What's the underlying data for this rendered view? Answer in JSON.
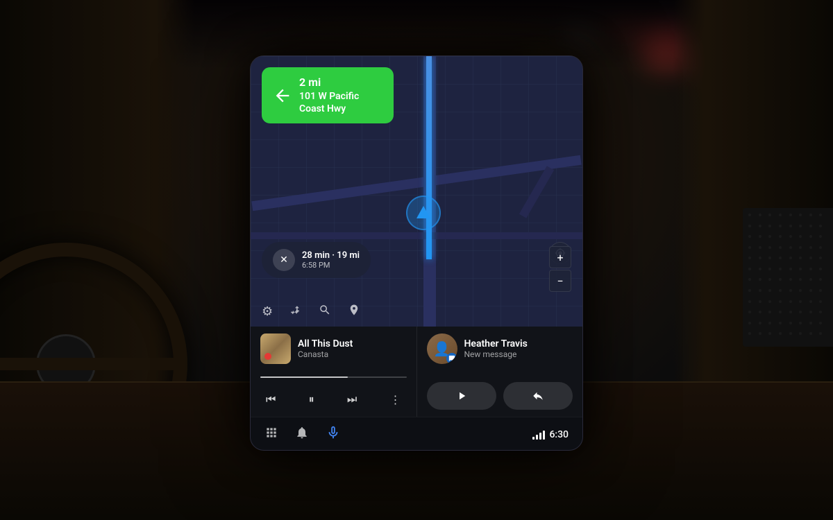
{
  "background": {
    "color": "#0d0d12"
  },
  "screen": {
    "navigation": {
      "distance": "2 mi",
      "street": "101 W Pacific",
      "street2": "Coast Hwy",
      "trip_duration": "28 min · 19 mi",
      "trip_eta": "6:58 PM"
    },
    "map_controls": {
      "settings_icon": "⚙",
      "alt_route_icon": "⇌",
      "search_icon": "🔍",
      "pin_icon": "📍",
      "zoom_plus": "+",
      "zoom_minus": "−"
    },
    "music": {
      "track_name": "All This Dust",
      "artist": "Canasta",
      "prev_icon": "⏮",
      "pause_icon": "⏸",
      "next_icon": "⏭",
      "more_icon": "⋮",
      "progress_percent": 60
    },
    "message": {
      "contact_name": "Heather Travis",
      "preview": "New message",
      "play_icon": "▶",
      "reply_icon": "↩"
    },
    "bottom_nav": {
      "apps_icon": "⊞",
      "bell_icon": "🔔",
      "mic_icon": "🎙",
      "time": "6:30"
    }
  }
}
